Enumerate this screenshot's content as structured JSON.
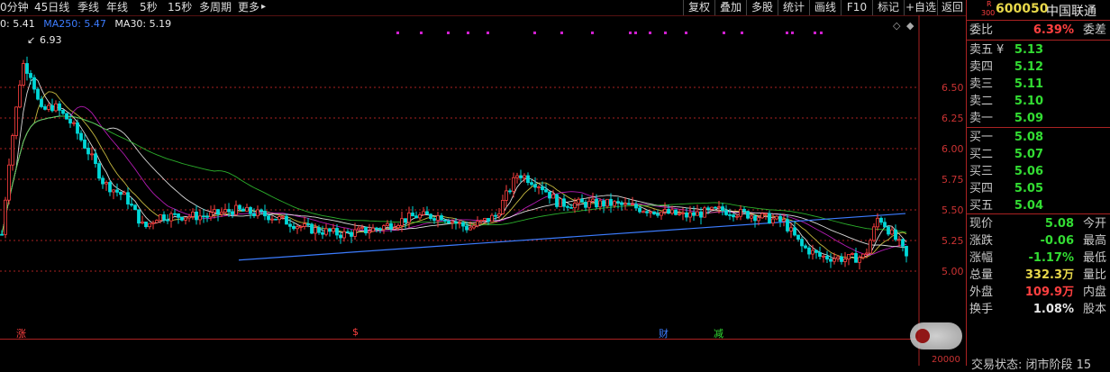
{
  "toolbar": {
    "periods": [
      "0分钟",
      "45日线",
      "季线",
      "年线",
      "5秒",
      "15秒",
      "多周期",
      "更多"
    ],
    "more_arrow": "▸",
    "buttons": [
      "复权",
      "叠加",
      "多股",
      "统计",
      "画线",
      "F10",
      "标记",
      "+自选",
      "返回"
    ]
  },
  "legend": {
    "current": "0: 5.41",
    "ma250_label": "MA250:",
    "ma250_value": "5.47",
    "ma30_label": "MA30:",
    "ma30_value": "5.19",
    "high_label": "6.93"
  },
  "colors": {
    "up": "#ff4040",
    "down": "#00d8d8",
    "ma250": "#3c7cff",
    "ma30": "#ffffff",
    "grid": "#aa2222",
    "quote_green": "#33dd33",
    "magenta": "#d020d0"
  },
  "price_axis": [
    "6.50",
    "6.25",
    "6.00",
    "5.75",
    "5.50",
    "5.25",
    "5.00"
  ],
  "markers": [
    {
      "text": "涨",
      "color": "#ff4040"
    },
    {
      "text": "$",
      "color": "#ff4040"
    },
    {
      "text": "财",
      "color": "#3c7cff"
    },
    {
      "text": "减",
      "color": "#33dd33"
    }
  ],
  "volume_label": "20000",
  "quote": {
    "badge_top": "R",
    "badge_bottom": "300",
    "code": "600050",
    "name": "中国联通",
    "weibi_label": "委比",
    "weibi_value": "6.39%",
    "weicha_label": "委差",
    "sell": [
      {
        "label": "卖五",
        "flag": "¥",
        "value": "5.13"
      },
      {
        "label": "卖四",
        "flag": "",
        "value": "5.12"
      },
      {
        "label": "卖三",
        "flag": "",
        "value": "5.11"
      },
      {
        "label": "卖二",
        "flag": "",
        "value": "5.10"
      },
      {
        "label": "卖一",
        "flag": "",
        "value": "5.09"
      }
    ],
    "buy": [
      {
        "label": "买一",
        "value": "5.08"
      },
      {
        "label": "买二",
        "value": "5.07"
      },
      {
        "label": "买三",
        "value": "5.06"
      },
      {
        "label": "买四",
        "value": "5.05"
      },
      {
        "label": "买五",
        "value": "5.04"
      }
    ],
    "stats": [
      {
        "label": "现价",
        "value": "5.08",
        "right": "今开",
        "color": "#33dd33"
      },
      {
        "label": "涨跌",
        "value": "-0.06",
        "right": "最高",
        "color": "#33dd33"
      },
      {
        "label": "涨幅",
        "value": "-1.17%",
        "right": "最低",
        "color": "#33dd33"
      },
      {
        "label": "总量",
        "value": "332.3万",
        "right": "量比",
        "color": "#e8d84a"
      },
      {
        "label": "外盘",
        "value": "109.9万",
        "right": "内盘",
        "color": "#ff4040"
      },
      {
        "label": "换手",
        "value": "1.08%",
        "right": "股本",
        "color": "#e8e8e8"
      }
    ],
    "status": "交易状态: 闭市阶段 15"
  }
}
